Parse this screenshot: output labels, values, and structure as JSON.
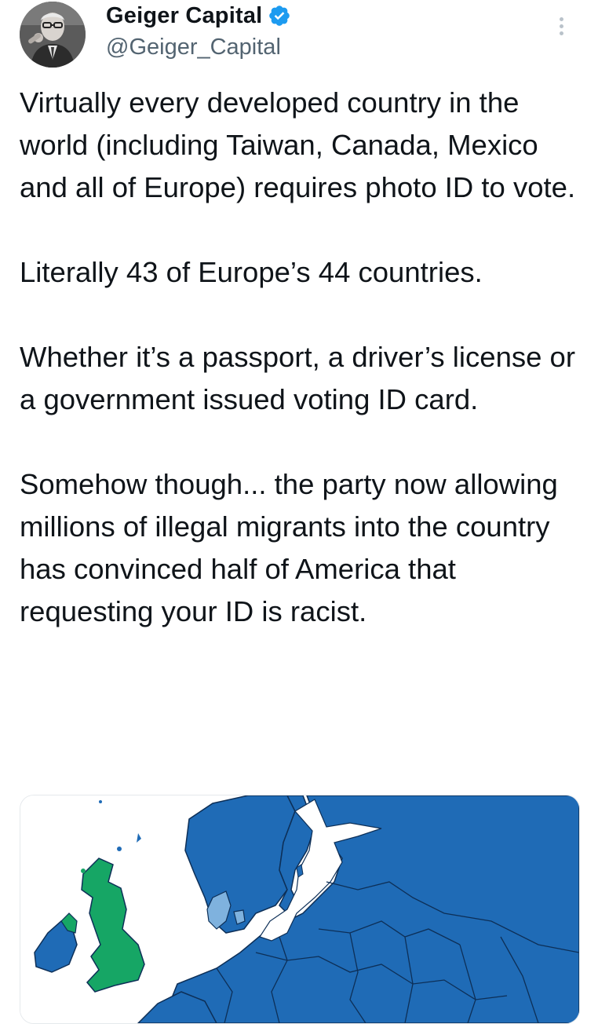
{
  "author": {
    "display_name": "Geiger Capital",
    "handle": "@Geiger_Capital",
    "verified": true,
    "avatar_icon": "profile-photo",
    "verified_icon": "verified-badge-icon"
  },
  "tweet": {
    "paragraphs": [
      "Virtually every developed country in the world (including Taiwan, Canada, Mexico and all of Europe) requires photo ID to vote.",
      "Literally 43 of Europe’s 44 countries.",
      "Whether it’s a passport, a driver’s license or a government issued voting ID card.",
      "Somehow though... the party now allowing millions of illegal migrants into the country has convinced half of America that requesting your ID is racist."
    ]
  },
  "media": {
    "type": "map-image",
    "colors": {
      "land_blue": "#1f6bb6",
      "uk_green": "#16a665",
      "denmark_light": "#7fb2de",
      "sea": "#ffffff",
      "border": "#0d2f57"
    }
  },
  "colors": {
    "text": "#0f1419",
    "secondary": "#536471",
    "verified": "#1d9bf0"
  }
}
